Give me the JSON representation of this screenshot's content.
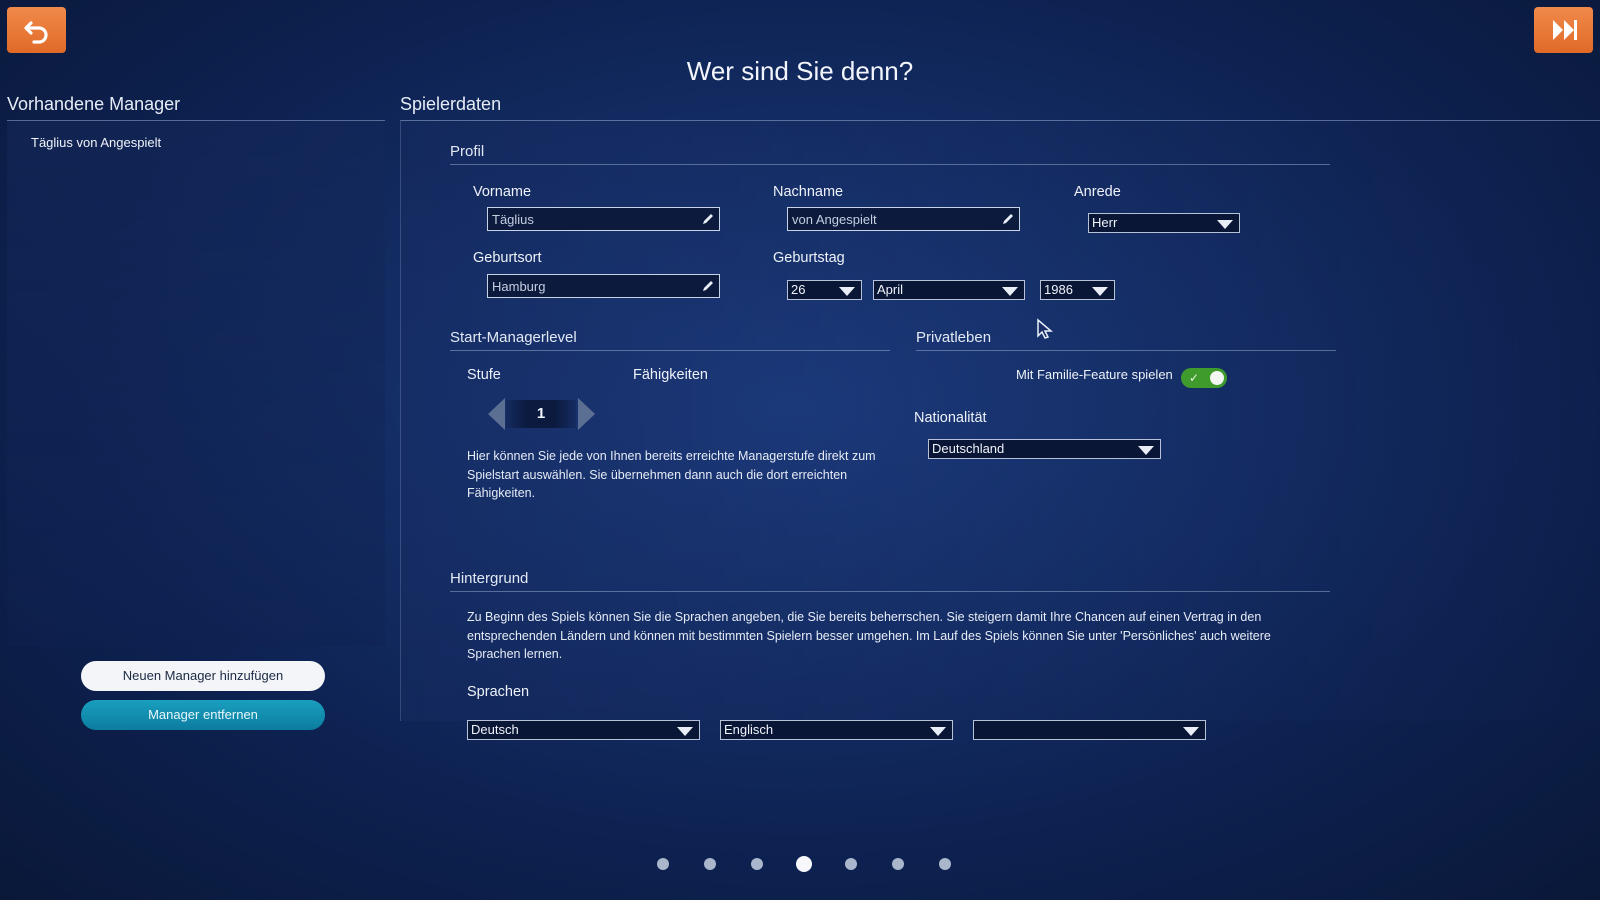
{
  "page": {
    "title": "Wer sind Sie denn?"
  },
  "left": {
    "heading": "Vorhandene Manager",
    "managers": [
      "Täglius von Angespielt"
    ],
    "add_button": "Neuen Manager hinzufügen",
    "remove_button": "Manager entfernen"
  },
  "right": {
    "heading": "Spielerdaten",
    "profile": {
      "heading": "Profil",
      "firstname_label": "Vorname",
      "firstname_value": "Täglius",
      "lastname_label": "Nachname",
      "lastname_value": "von Angespielt",
      "salutation_label": "Anrede",
      "salutation_value": "Herr",
      "birthplace_label": "Geburtsort",
      "birthplace_value": "Hamburg",
      "birthday_label": "Geburtstag",
      "birth_day": "26",
      "birth_month": "April",
      "birth_year": "1986"
    },
    "level": {
      "heading": "Start-Managerlevel",
      "stage_label": "Stufe",
      "skills_label": "Fähigkeiten",
      "stage_value": "1",
      "description": "Hier können Sie jede von Ihnen bereits erreichte Managerstufe direkt zum Spielstart auswählen. Sie übernehmen dann auch die dort erreichten Fähigkeiten."
    },
    "private": {
      "heading": "Privatleben",
      "family_label": "Mit Familie-Feature spielen",
      "family_enabled": true,
      "nationality_label": "Nationalität",
      "nationality_value": "Deutschland"
    },
    "background": {
      "heading": "Hintergrund",
      "description": "Zu Beginn des Spiels können Sie die Sprachen angeben, die Sie bereits beherrschen. Sie steigern damit Ihre Chancen auf einen Vertrag in den entsprechenden Ländern und können mit bestimmten Spielern besser umgehen. Im Lauf des Spiels können Sie unter 'Persönliches' auch weitere Sprachen lernen.",
      "languages_label": "Sprachen",
      "languages": [
        "Deutsch",
        "Englisch",
        ""
      ]
    }
  },
  "pagination": {
    "total": 7,
    "active_index": 3
  },
  "icons": {
    "back": "undo-arrow-icon",
    "forward": "fast-forward-icon",
    "edit": "pencil-icon",
    "dropdown": "triangle-down-icon"
  },
  "colors": {
    "accent_orange": "#e8783a",
    "toggle_green": "#3e9b2c",
    "remove_button": "#1290b2"
  }
}
